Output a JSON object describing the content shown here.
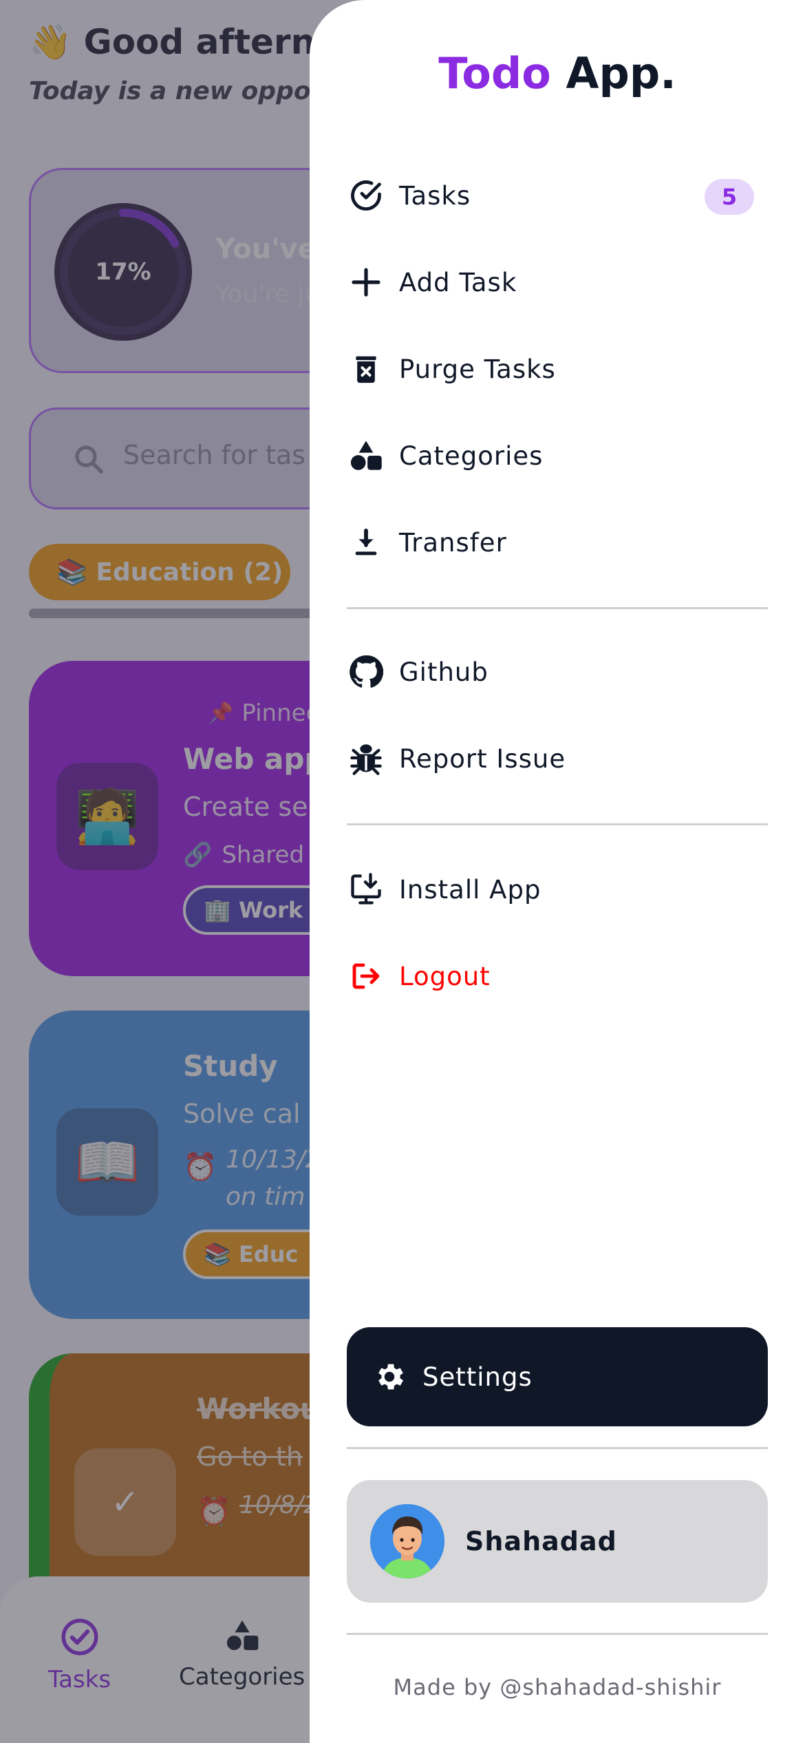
{
  "background": {
    "greeting": "👋 Good afternoon",
    "greeting_sub": "Today is a new opportunity",
    "progress": {
      "percent_label": "17%",
      "percent_value": 17,
      "title": "You've",
      "description": "You're ju"
    },
    "search_placeholder": "Search for tas",
    "category_chip": "📚 Education (2)",
    "tasks": [
      {
        "emoji": "🧑‍💻",
        "pinned_label": "Pinned",
        "title": "Web app",
        "description": "Create se",
        "shared_label": "Shared",
        "chip": "🏢 Work",
        "color": "#9d1ae6"
      },
      {
        "emoji": "📖",
        "title": "Study",
        "description": "Solve cal",
        "date_line1": "10/13/2",
        "date_line2": "on tim",
        "chip": "📚 Educ",
        "color": "#4a97e6"
      },
      {
        "emoji": "✓",
        "title": "Workou",
        "description": "Go to th",
        "date_line1": "10/8/2",
        "color": "#b8690f",
        "done_color": "#19a31d"
      }
    ],
    "bottom_nav": [
      {
        "label": "Tasks",
        "active": true
      },
      {
        "label": "Categories",
        "active": false
      }
    ]
  },
  "drawer": {
    "brand_accent": "Todo",
    "brand_rest": " App.",
    "accent_color": "#8a2be2",
    "menu": [
      {
        "label": "Tasks",
        "icon": "check-circle-icon",
        "badge": "5"
      },
      {
        "label": "Add Task",
        "icon": "plus-icon"
      },
      {
        "label": "Purge Tasks",
        "icon": "trash-icon"
      },
      {
        "label": "Categories",
        "icon": "shapes-icon"
      },
      {
        "label": "Transfer",
        "icon": "download-icon"
      }
    ],
    "links": [
      {
        "label": "Github",
        "icon": "github-icon"
      },
      {
        "label": "Report Issue",
        "icon": "bug-icon"
      }
    ],
    "actions": [
      {
        "label": "Install App",
        "icon": "install-icon"
      },
      {
        "label": "Logout",
        "icon": "logout-icon",
        "color": "#ff0000"
      }
    ],
    "settings_label": "Settings",
    "profile_name": "Shahadad",
    "credit": "Made by @shahadad-shishir"
  }
}
